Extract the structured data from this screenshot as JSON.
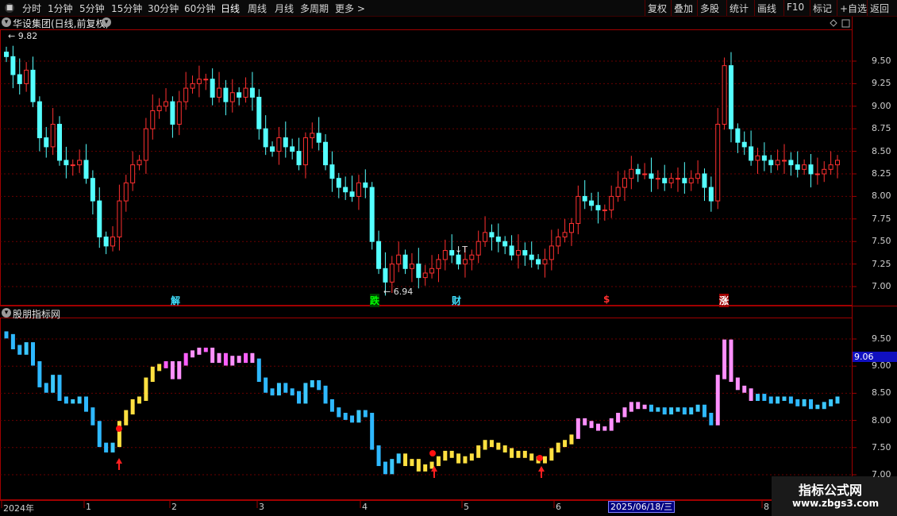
{
  "toolbar": {
    "left": [
      "分时",
      "1分钟",
      "5分钟",
      "15分钟",
      "30分钟",
      "60分钟",
      "日线",
      "周线",
      "月线",
      "多周期",
      "更多 >"
    ],
    "right": [
      "复权",
      "叠加",
      "多股",
      "统计",
      "画线",
      "F10",
      "标记",
      "+自选",
      "返回"
    ]
  },
  "price_panel": {
    "title": "华设集团(日线,前复权)",
    "y_ticks": [
      "9.50",
      "9.25",
      "9.00",
      "8.75",
      "8.50",
      "8.25",
      "8.00",
      "7.75",
      "7.50",
      "7.25",
      "7.00"
    ],
    "high_label": "9.82",
    "low_label": "6.94",
    "t_label": "↓T",
    "events": [
      {
        "text": "解",
        "color": "#40e0ff"
      },
      {
        "text": "跌",
        "color": "#00ff00",
        "bg": "#004000"
      },
      {
        "text": "财",
        "color": "#40e0ff"
      },
      {
        "text": "$",
        "color": "#ff3030"
      },
      {
        "text": "涨",
        "color": "#ffffff",
        "bg": "#a00000"
      }
    ]
  },
  "indicator_panel": {
    "title": "股朋指标网",
    "y_ticks": [
      "9.50",
      "9.00",
      "8.50",
      "8.00",
      "7.50",
      "7.00"
    ],
    "value_badge": "9.06"
  },
  "x_axis": {
    "labels": [
      "2024年",
      "1",
      "2",
      "3",
      "4",
      "5",
      "6",
      "8"
    ],
    "cursor_date": "2025/06/18/三"
  },
  "watermark": {
    "line1": "指标公式网",
    "line2": "www.zbgs3.com"
  },
  "colors": {
    "up": "#ff3030",
    "down": "#54ffff",
    "grid": "#6a0000",
    "axis": "#a00000"
  },
  "chart_data": {
    "type": "candlestick",
    "y_range": [
      6.94,
      9.82
    ],
    "closes": [
      9.55,
      9.35,
      9.25,
      9.4,
      9.05,
      8.65,
      8.55,
      8.8,
      8.4,
      8.35,
      8.35,
      8.4,
      8.2,
      7.95,
      7.55,
      7.45,
      7.55,
      7.95,
      8.15,
      8.35,
      8.4,
      8.75,
      8.95,
      9.0,
      9.05,
      8.8,
      9.05,
      9.2,
      9.25,
      9.3,
      9.3,
      9.1,
      9.2,
      9.05,
      9.15,
      9.1,
      9.2,
      9.1,
      8.75,
      8.55,
      8.5,
      8.65,
      8.55,
      8.5,
      8.35,
      8.65,
      8.7,
      8.6,
      8.35,
      8.2,
      8.1,
      8.05,
      8.0,
      8.15,
      8.1,
      7.5,
      7.2,
      7.05,
      7.25,
      7.35,
      7.2,
      7.25,
      7.1,
      7.15,
      7.2,
      7.3,
      7.4,
      7.35,
      7.25,
      7.3,
      7.35,
      7.5,
      7.6,
      7.55,
      7.5,
      7.45,
      7.35,
      7.4,
      7.35,
      7.3,
      7.25,
      7.3,
      7.45,
      7.55,
      7.6,
      7.7,
      8.0,
      7.95,
      7.9,
      7.85,
      7.85,
      8.0,
      8.1,
      8.2,
      8.3,
      8.25,
      8.25,
      8.2,
      8.2,
      8.15,
      8.2,
      8.2,
      8.15,
      8.2,
      8.25,
      8.1,
      7.95,
      8.8,
      9.45,
      8.75,
      8.6,
      8.55,
      8.4,
      8.45,
      8.4,
      8.35,
      8.4,
      8.4,
      8.35,
      8.3,
      8.35,
      8.25,
      8.25,
      8.3,
      8.35,
      8.4
    ],
    "indicator_colors": [
      "cyan",
      "yellow",
      "red",
      "pink",
      "magenta"
    ],
    "signal_arrows": 3
  }
}
